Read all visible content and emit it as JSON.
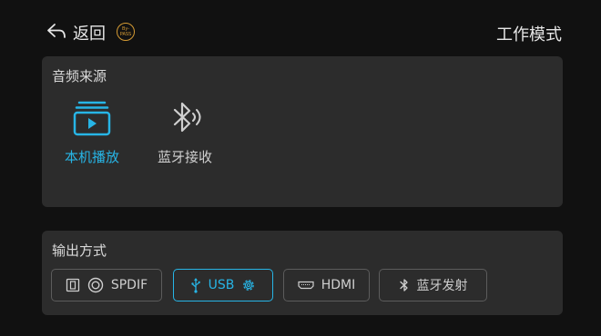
{
  "header": {
    "back_label": "返回",
    "bypass_top": "By-",
    "bypass_bottom": "PASS",
    "title": "工作模式"
  },
  "source": {
    "title": "音频来源",
    "items": [
      {
        "label": "本机播放",
        "icon": "local-play-icon",
        "selected": true
      },
      {
        "label": "蓝牙接收",
        "icon": "bluetooth-receive-icon",
        "selected": false
      }
    ]
  },
  "output": {
    "title": "输出方式",
    "options": [
      {
        "label": "SPDIF",
        "icons": [
          "optical-port-icon",
          "coaxial-port-icon"
        ],
        "selected": false
      },
      {
        "label": "USB",
        "icons": [
          "usb-icon",
          "gear-icon"
        ],
        "selected": true
      },
      {
        "label": "HDMI",
        "icons": [
          "hdmi-port-icon"
        ],
        "selected": false
      },
      {
        "label": "蓝牙发射",
        "icons": [
          "bluetooth-icon"
        ],
        "selected": false
      }
    ]
  },
  "colors": {
    "accent": "#27b5e6",
    "bypass": "#d49a34",
    "panel": "#2c2c2c",
    "background": "#111111"
  }
}
